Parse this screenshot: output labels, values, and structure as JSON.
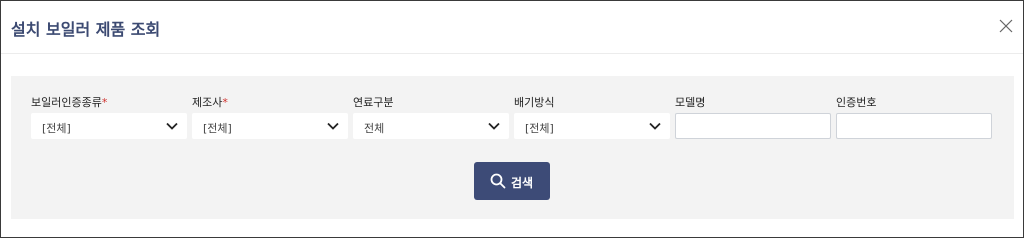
{
  "dialog": {
    "title": "설치 보일러 제품 조회",
    "close_icon": "close-icon"
  },
  "filters": {
    "boiler_cert_type": {
      "label": "보일러인증종류",
      "required": "*",
      "value": "[전체]",
      "icon": "chevron-down-icon"
    },
    "manufacturer": {
      "label": "제조사",
      "required": "*",
      "value": "[전체]",
      "icon": "chevron-down-icon"
    },
    "fuel_type": {
      "label": "연료구분",
      "value": "전체",
      "icon": "chevron-down-icon"
    },
    "exhaust_method": {
      "label": "배기방식",
      "value": "[전체]",
      "icon": "chevron-down-icon"
    },
    "model_name": {
      "label": "모델명",
      "value": ""
    },
    "cert_number": {
      "label": "인증번호",
      "value": ""
    }
  },
  "search_button": {
    "label": "검색",
    "icon": "search-icon"
  },
  "colors": {
    "title": "#3c4a72",
    "button_bg": "#3d4b77",
    "panel_bg": "#f3f3f3",
    "required_mark": "#d0312d"
  }
}
